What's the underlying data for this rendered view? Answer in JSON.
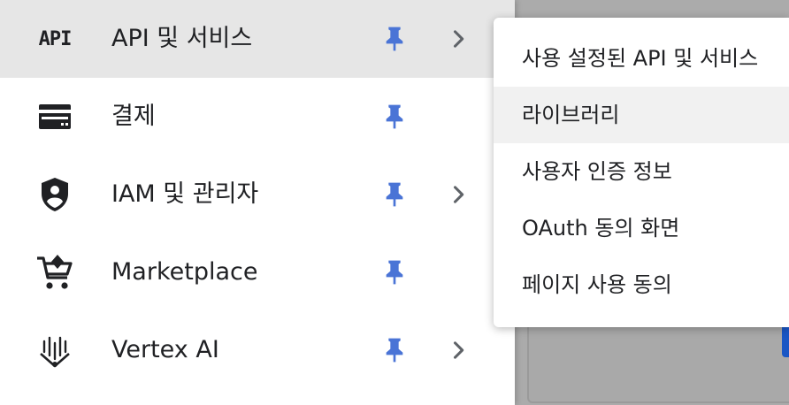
{
  "nav": {
    "items": [
      {
        "label": "API 및 서비스",
        "icon": "api-icon",
        "pinned": true,
        "has_submenu": true,
        "active": true
      },
      {
        "label": "결제",
        "icon": "billing-card-icon",
        "pinned": true,
        "has_submenu": false,
        "active": false
      },
      {
        "label": "IAM 및 관리자",
        "icon": "iam-shield-icon",
        "pinned": true,
        "has_submenu": true,
        "active": false
      },
      {
        "label": "Marketplace",
        "icon": "marketplace-cart-icon",
        "pinned": true,
        "has_submenu": false,
        "active": false
      },
      {
        "label": "Vertex AI",
        "icon": "vertex-ai-icon",
        "pinned": true,
        "has_submenu": true,
        "active": false
      }
    ],
    "api_icon_text": "API"
  },
  "submenu": {
    "items": [
      {
        "label": "사용 설정된 API 및 서비스"
      },
      {
        "label": "라이브러리"
      },
      {
        "label": "사용자 인증 정보"
      },
      {
        "label": "OAuth 동의 화면"
      },
      {
        "label": "페이지 사용 동의"
      }
    ]
  },
  "colors": {
    "pin": "#4a74d6",
    "chevron": "#5f6368",
    "active_bg": "#e6e6e6",
    "hover_bg": "#f1f1f1",
    "text": "#202124"
  }
}
